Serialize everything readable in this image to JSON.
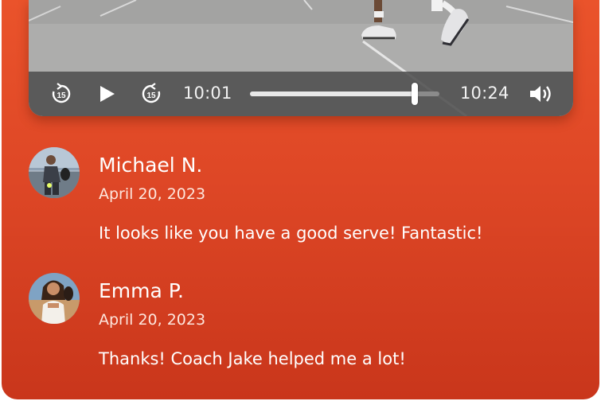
{
  "player": {
    "current_time": "10:01",
    "total_time": "10:24",
    "progress": 0.87,
    "skip_back_seconds": "15",
    "skip_forward_seconds": "15"
  },
  "comments": [
    {
      "name": "Michael N.",
      "date": "April 20, 2023",
      "text": "It looks like you have a good serve! Fantastic!"
    },
    {
      "name": "Emma P.",
      "date": "April 20, 2023",
      "text": "Thanks! Coach Jake helped me a lot!"
    }
  ],
  "colors": {
    "card_top": "#ea532b",
    "card_bottom": "#c9361b",
    "controls_bg": "#4e4e4e"
  }
}
